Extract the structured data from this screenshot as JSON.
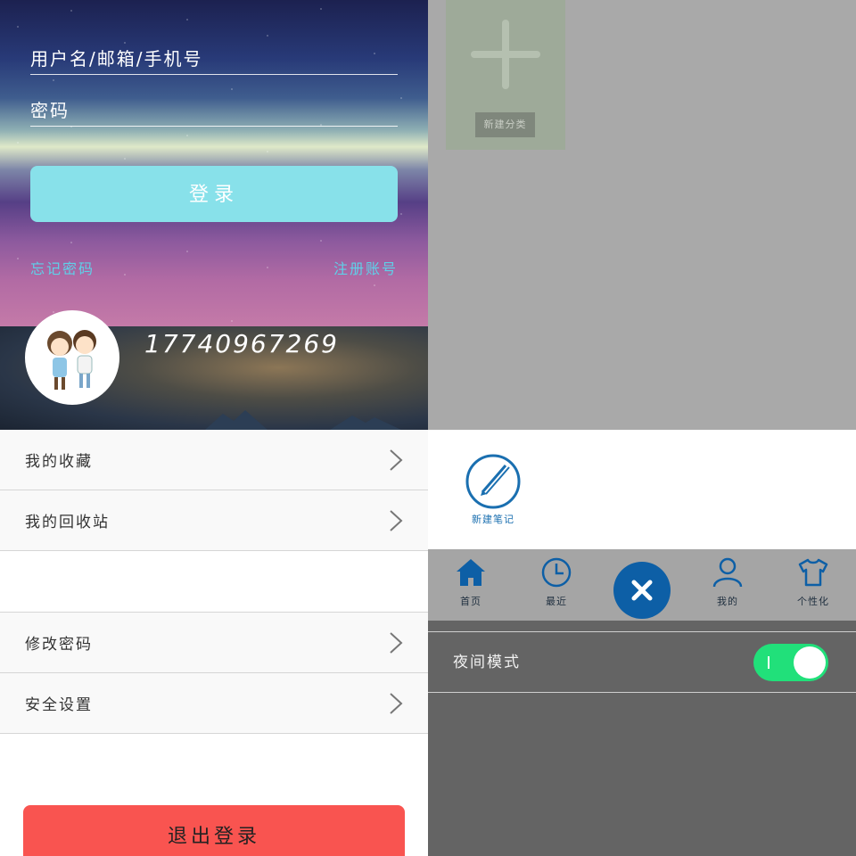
{
  "login": {
    "username_placeholder": "用户名/邮箱/手机号",
    "password_placeholder": "密码",
    "login_button": "登录",
    "forgot_password": "忘记密码",
    "register": "注册账号"
  },
  "profile": {
    "phone": "17740967269",
    "menu_group1": [
      "我的收藏",
      "我的回收站"
    ],
    "menu_group2": [
      "修改密码",
      "安全设置"
    ],
    "logout_button": "退出登录"
  },
  "category": {
    "new_category_label": "新建分类"
  },
  "note": {
    "new_note_label": "新建笔记"
  },
  "tabbar": {
    "tabs": [
      {
        "label": "首页",
        "icon": "home-icon"
      },
      {
        "label": "最近",
        "icon": "clock-icon"
      },
      {
        "label": "",
        "icon": "close-icon"
      },
      {
        "label": "我的",
        "icon": "person-icon"
      },
      {
        "label": "个性化",
        "icon": "shirt-icon"
      }
    ]
  },
  "settings": {
    "night_mode_label": "夜间模式",
    "night_mode_on": true
  },
  "colors": {
    "accent_blue": "#0d5fa6",
    "login_button": "#88e1ea",
    "logout_button": "#f95450",
    "toggle_on": "#21e07a"
  }
}
